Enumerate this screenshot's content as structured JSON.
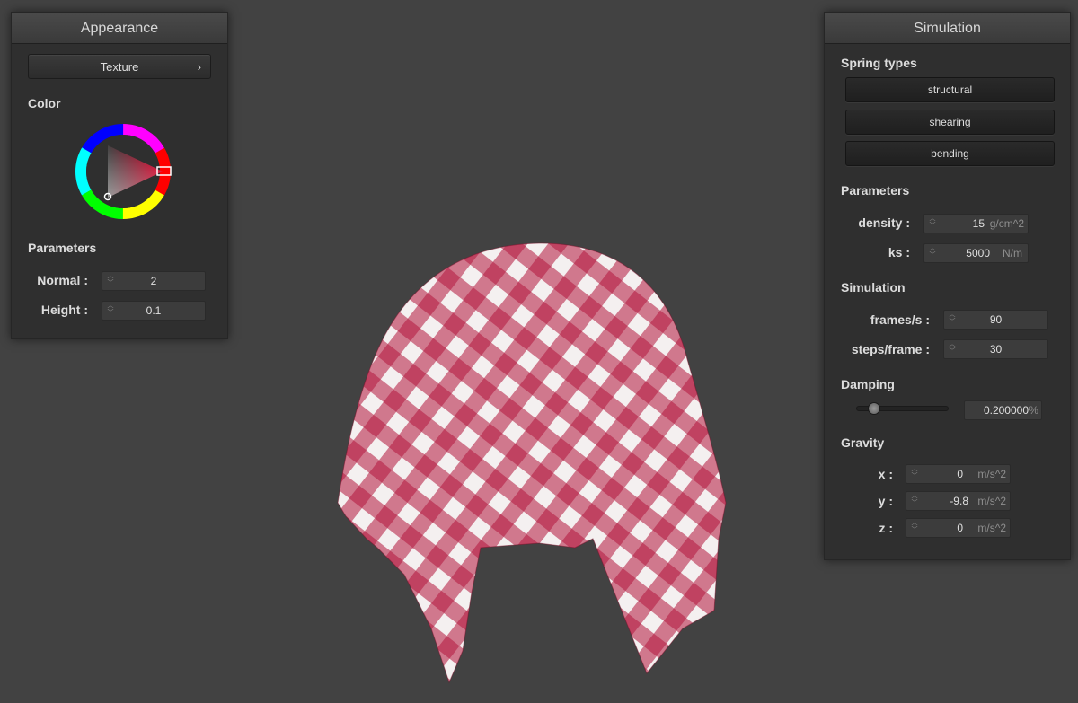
{
  "appearance": {
    "title": "Appearance",
    "texture_button": "Texture",
    "texture_chevron": "›",
    "color_label": "Color",
    "parameters_label": "Parameters",
    "normal": {
      "label": "Normal :",
      "value": "2"
    },
    "height": {
      "label": "Height :",
      "value": "0.1"
    },
    "selected_color": "#e0002a"
  },
  "simulation": {
    "title": "Simulation",
    "spring_types_label": "Spring types",
    "spring_types": [
      "structural",
      "shearing",
      "bending"
    ],
    "parameters_label": "Parameters",
    "density": {
      "label": "density :",
      "value": "15",
      "unit": "g/cm^2"
    },
    "ks": {
      "label": "ks :",
      "value": "5000",
      "unit": "N/m"
    },
    "simulation_label": "Simulation",
    "fps": {
      "label": "frames/s :",
      "value": "90"
    },
    "steps": {
      "label": "steps/frame :",
      "value": "30"
    },
    "damping_label": "Damping",
    "damping": {
      "value": "0.200000",
      "unit": "%",
      "slider_fraction": 0.2
    },
    "gravity_label": "Gravity",
    "gravity": [
      {
        "label": "x :",
        "value": "0",
        "unit": "m/s^2"
      },
      {
        "label": "y :",
        "value": "-9.8",
        "unit": "m/s^2"
      },
      {
        "label": "z :",
        "value": "0",
        "unit": "m/s^2"
      }
    ]
  },
  "cloth": {
    "color_a": "#b3163c",
    "color_b": "#f4f0f0"
  }
}
